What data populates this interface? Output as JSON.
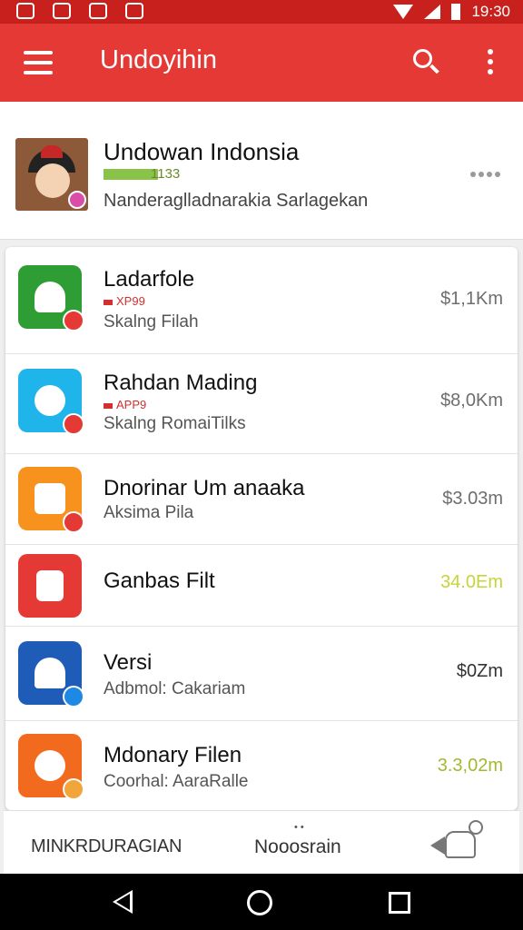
{
  "status_bar": {
    "time": "19:30"
  },
  "app_bar": {
    "title": "Undoyihin"
  },
  "profile": {
    "name": "Undowan Indonsia",
    "code": "1133",
    "subtitle": "Nanderaglladnarakia Sarlagekan"
  },
  "items": [
    {
      "title": "Ladarfole",
      "tag": "XP99",
      "subtitle": "Skalng Filah",
      "price": "$1,1Km",
      "icon": "android-app-icon",
      "icon_color": "#2e9e34",
      "badge_color": "#e53935",
      "price_color": "#6e6e6e"
    },
    {
      "title": "Rahdan Mading",
      "tag": "APP9",
      "subtitle": "Skalng RomaiTilks",
      "price": "$8,0Km",
      "icon": "cloud-app-icon",
      "icon_color": "#1fb5ea",
      "badge_color": "#e53935",
      "price_color": "#6e6e6e"
    },
    {
      "title": "Dnorinar Um anaaka",
      "tag": "",
      "subtitle": "Aksima Pila",
      "price": "$3.03m",
      "icon": "home-app-icon",
      "icon_color": "#f7921e",
      "badge_color": "#e53935",
      "price_color": "#6e6e6e"
    },
    {
      "title": "Ganbas Filt",
      "tag": "",
      "subtitle": "",
      "price": "34.0Em",
      "icon": "document-app-icon",
      "icon_color": "#e53935",
      "badge_color": "",
      "price_color": "#c6d43a"
    },
    {
      "title": "Versi",
      "tag": "",
      "subtitle": "Adbmol: Cakariam",
      "price": "$0Zm",
      "icon": "home-app-icon",
      "icon_color": "#1e5cb8",
      "badge_color": "#1e88e5",
      "price_color": "#333333"
    },
    {
      "title": "Mdonary Filen",
      "tag": "",
      "subtitle": "Coorhal: AaraRalle",
      "price": "3.3,02m",
      "icon": "recycle-app-icon",
      "icon_color": "#f26a1d",
      "badge_color": "#f2a53b",
      "price_color": "#a4b930"
    }
  ],
  "bottom_nav": {
    "item1": "MINKRDURAGIAN",
    "item2": "Nooosrain",
    "item2_dots": "• •",
    "item3_icon": "robot-icon"
  },
  "system_nav": {
    "back": "back-icon",
    "home": "home-icon",
    "recents": "recents-icon"
  }
}
